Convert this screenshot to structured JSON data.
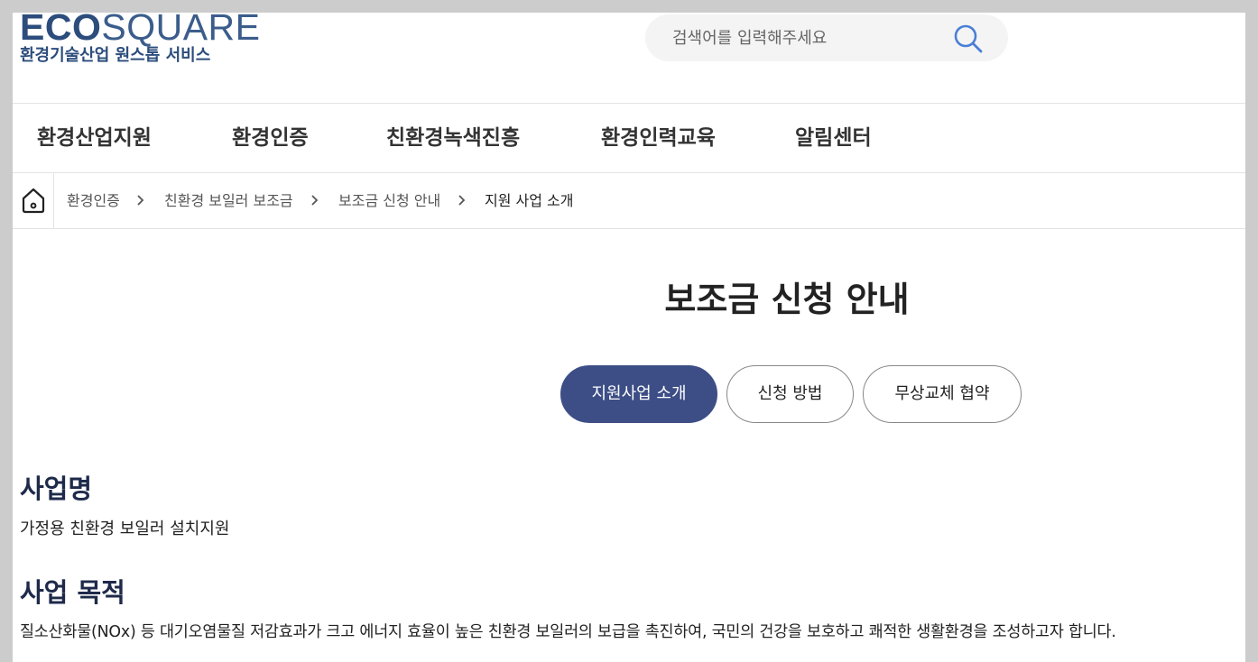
{
  "logo": {
    "word_bold": "ECO",
    "word_light": "SQUARE",
    "subtitle": "환경기술산업 원스톱 서비스"
  },
  "search": {
    "placeholder": "검색어를 입력해주세요",
    "value": ""
  },
  "gnb": {
    "items": [
      "환경산업지원",
      "환경인증",
      "친환경녹색진흥",
      "환경인력교육",
      "알림센터"
    ]
  },
  "breadcrumb": {
    "items": [
      "환경인증",
      "친환경 보일러 보조금",
      "보조금 신청 안내",
      "지원 사업 소개"
    ]
  },
  "page": {
    "title": "보조금 신청 안내"
  },
  "tabs": [
    {
      "label": "지원사업 소개",
      "active": true
    },
    {
      "label": "신청 방법",
      "active": false
    },
    {
      "label": "무상교체 협약",
      "active": false
    }
  ],
  "sections": [
    {
      "heading": "사업명",
      "body": "가정용 친환경 보일러 설치지원"
    },
    {
      "heading": "사업 목적",
      "body": "질소산화물(NOx) 등 대기오염물질 저감효과가 크고 에너지 효율이 높은 친환경 보일러의 보급을 촉진하여, 국민의 건강을 보호하고 쾌적한 생활환경을 조성하고자 합니다."
    }
  ],
  "colors": {
    "brand": "#2c4d7c",
    "tab_active": "#3d4e86",
    "search_icon": "#4a7fd6"
  },
  "icons": {
    "home": "home-icon",
    "search": "search-icon",
    "separator": "chevron-right-icon"
  }
}
